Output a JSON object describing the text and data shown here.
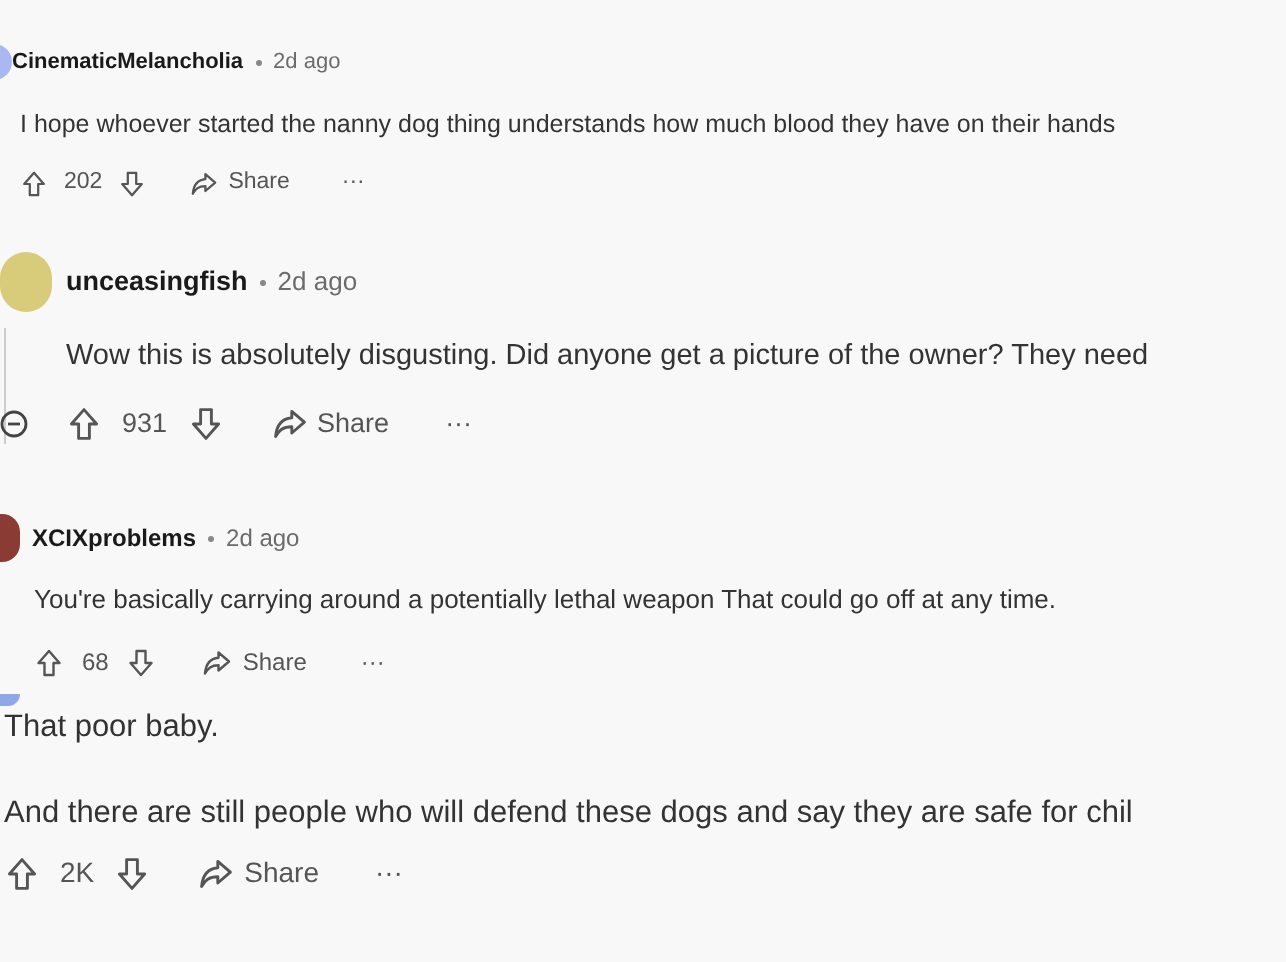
{
  "comments": [
    {
      "author": "CinematicMelancholia",
      "time": "2d ago",
      "body": [
        "I hope whoever started the nanny dog thing understands how much blood they have on their hands"
      ],
      "votes": "202",
      "share": "Share",
      "more": "···"
    },
    {
      "author": "unceasingfish",
      "time": "2d ago",
      "body": [
        "Wow this is absolutely disgusting. Did anyone get a picture of the owner? They need"
      ],
      "votes": "931",
      "share": "Share",
      "more": "···"
    },
    {
      "author": "XCIXproblems",
      "time": "2d ago",
      "body": [
        "You're basically carrying around a potentially lethal weapon That could go off at any time."
      ],
      "votes": "68",
      "share": "Share",
      "more": "···"
    },
    {
      "body": [
        "That poor baby.",
        "And there are still people who will defend these dogs and say they are safe for chil"
      ],
      "votes": "2K",
      "share": "Share",
      "more": "···"
    }
  ]
}
